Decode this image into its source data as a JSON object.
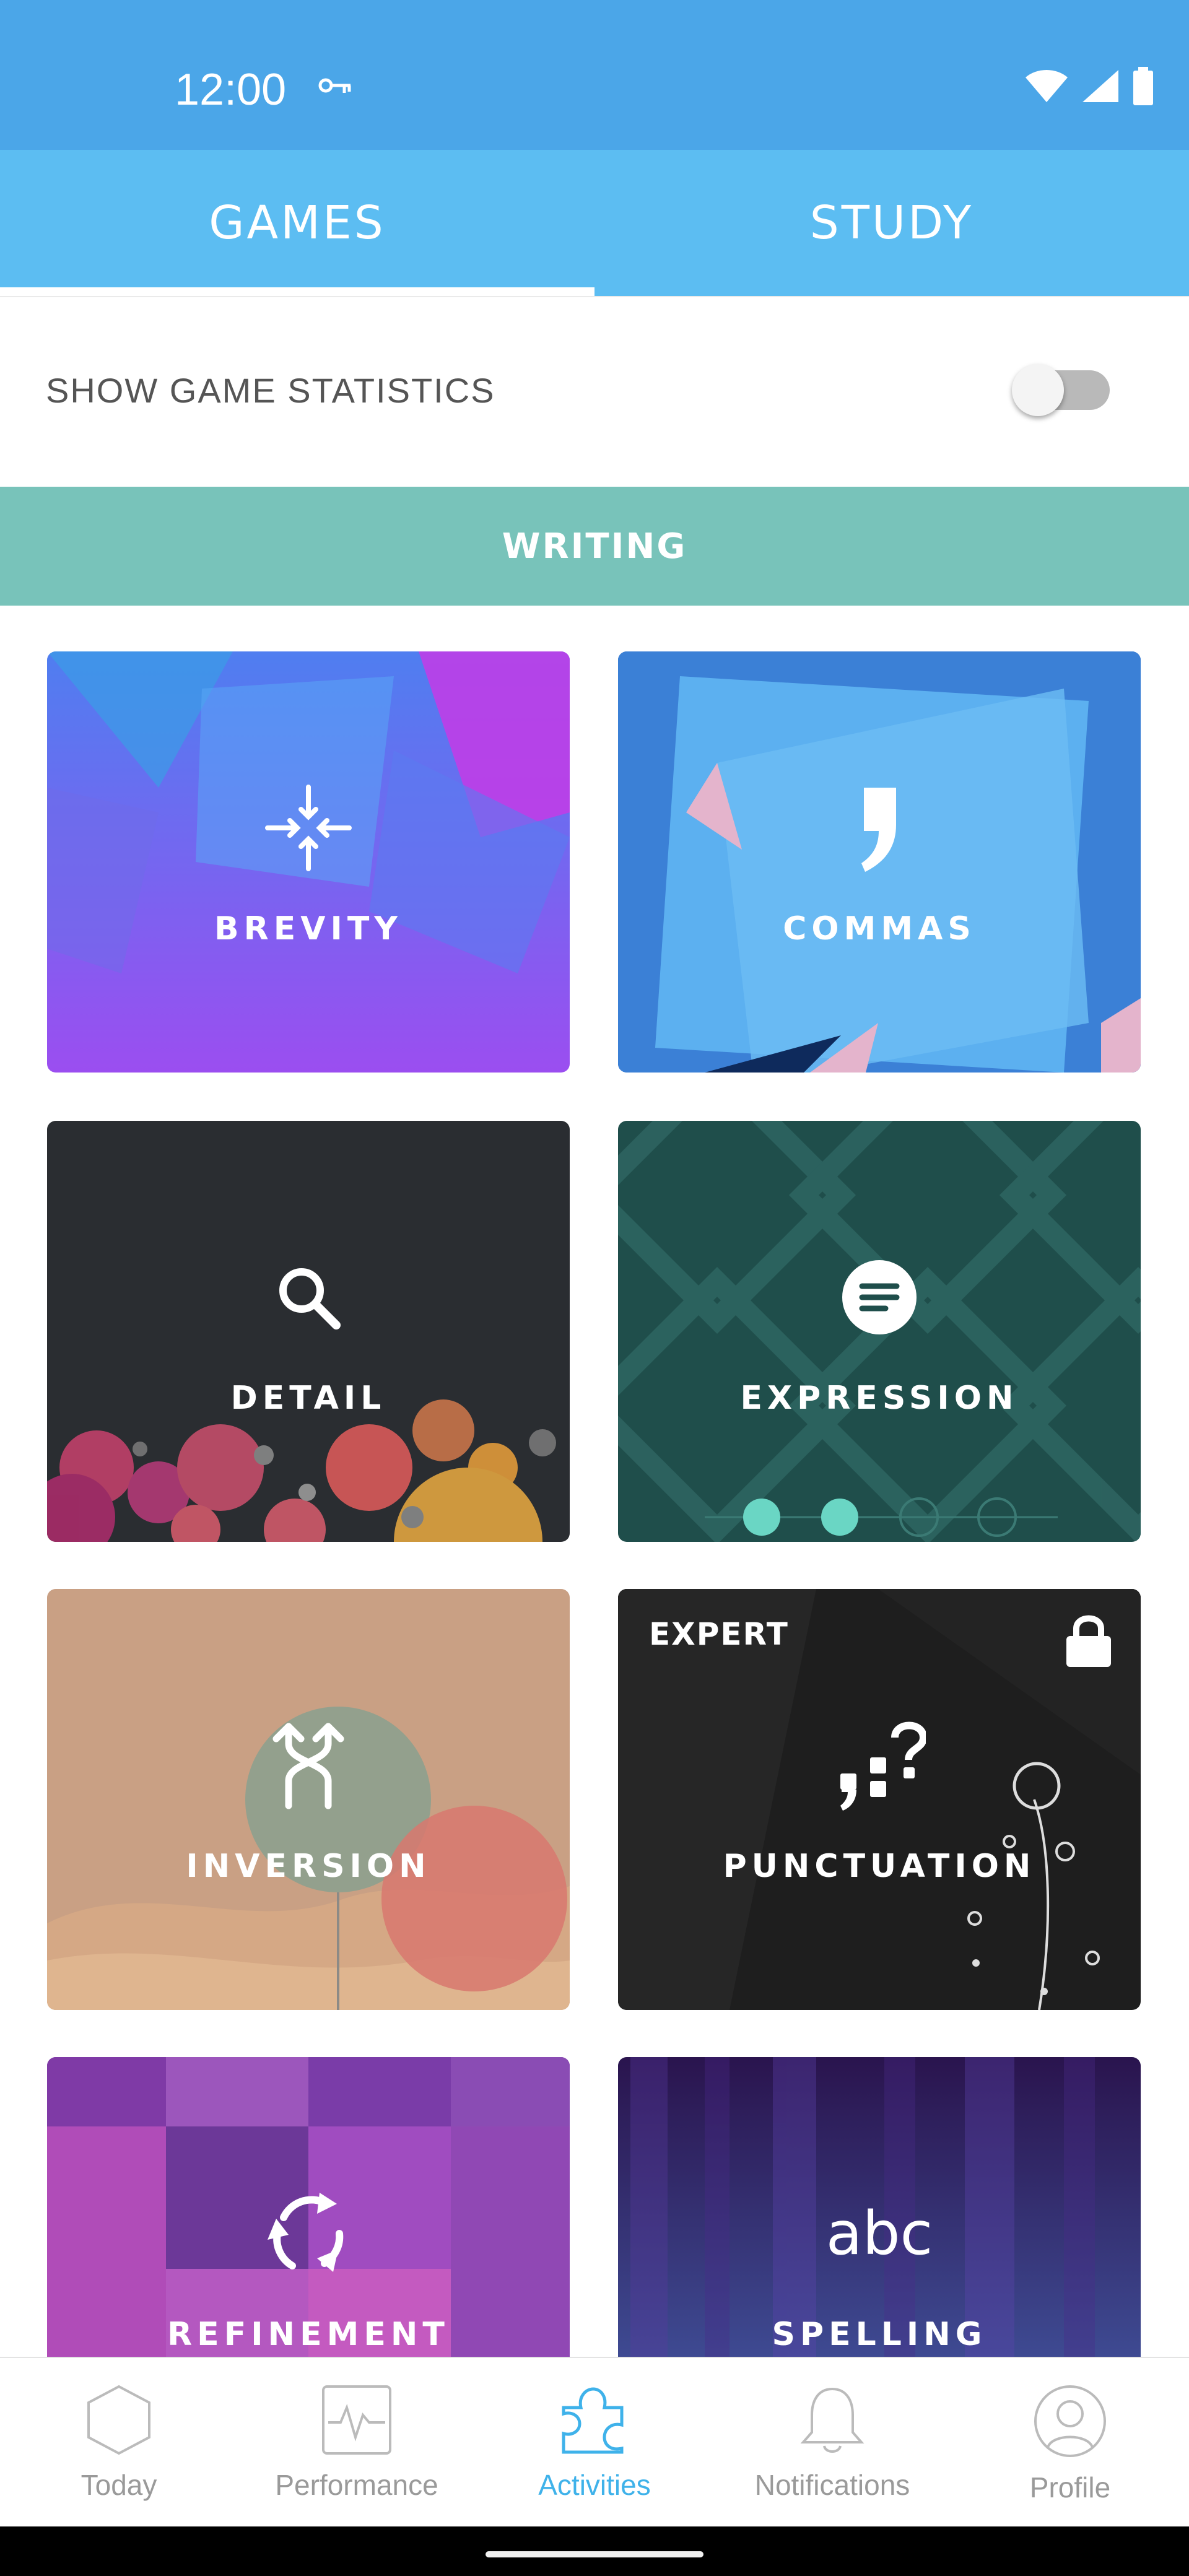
{
  "status_bar": {
    "time": "12:00",
    "icons": [
      "vpn-key-icon",
      "wifi-icon",
      "cellular-signal-icon",
      "battery-icon"
    ]
  },
  "tabs": [
    {
      "label": "GAMES",
      "active": true
    },
    {
      "label": "STUDY",
      "active": false
    }
  ],
  "stats_toggle": {
    "label": "SHOW GAME STATISTICS",
    "enabled": false
  },
  "section": {
    "title": "WRITING"
  },
  "games": [
    {
      "title": "BREVITY",
      "icon": "arrows-inward-icon"
    },
    {
      "title": "COMMAS",
      "icon": "comma-icon"
    },
    {
      "title": "DETAIL",
      "icon": "magnifier-icon"
    },
    {
      "title": "EXPRESSION",
      "icon": "text-bubble-icon"
    },
    {
      "title": "INVERSION",
      "icon": "swap-arrows-icon"
    },
    {
      "title": "PUNCTUATION",
      "icon": "punctuation-icon",
      "badge": "EXPERT",
      "locked": true
    },
    {
      "title": "REFINEMENT",
      "icon": "refresh-cycle-icon"
    },
    {
      "title": "SPELLING",
      "icon": "abc-text-icon",
      "icon_text": "abc"
    }
  ],
  "bottom_nav": [
    {
      "label": "Today",
      "icon": "hexagon-icon",
      "active": false
    },
    {
      "label": "Performance",
      "icon": "pulse-chart-icon",
      "active": false
    },
    {
      "label": "Activities",
      "icon": "puzzle-piece-icon",
      "active": true
    },
    {
      "label": "Notifications",
      "icon": "bell-icon",
      "active": false
    },
    {
      "label": "Profile",
      "icon": "person-icon",
      "active": false
    }
  ],
  "colors": {
    "status_bar": "#4ba6e8",
    "tabs": "#5cbdf2",
    "section_header": "#78c3ba",
    "nav_active": "#3fb2ea",
    "nav_inactive": "#9a9a9a"
  }
}
